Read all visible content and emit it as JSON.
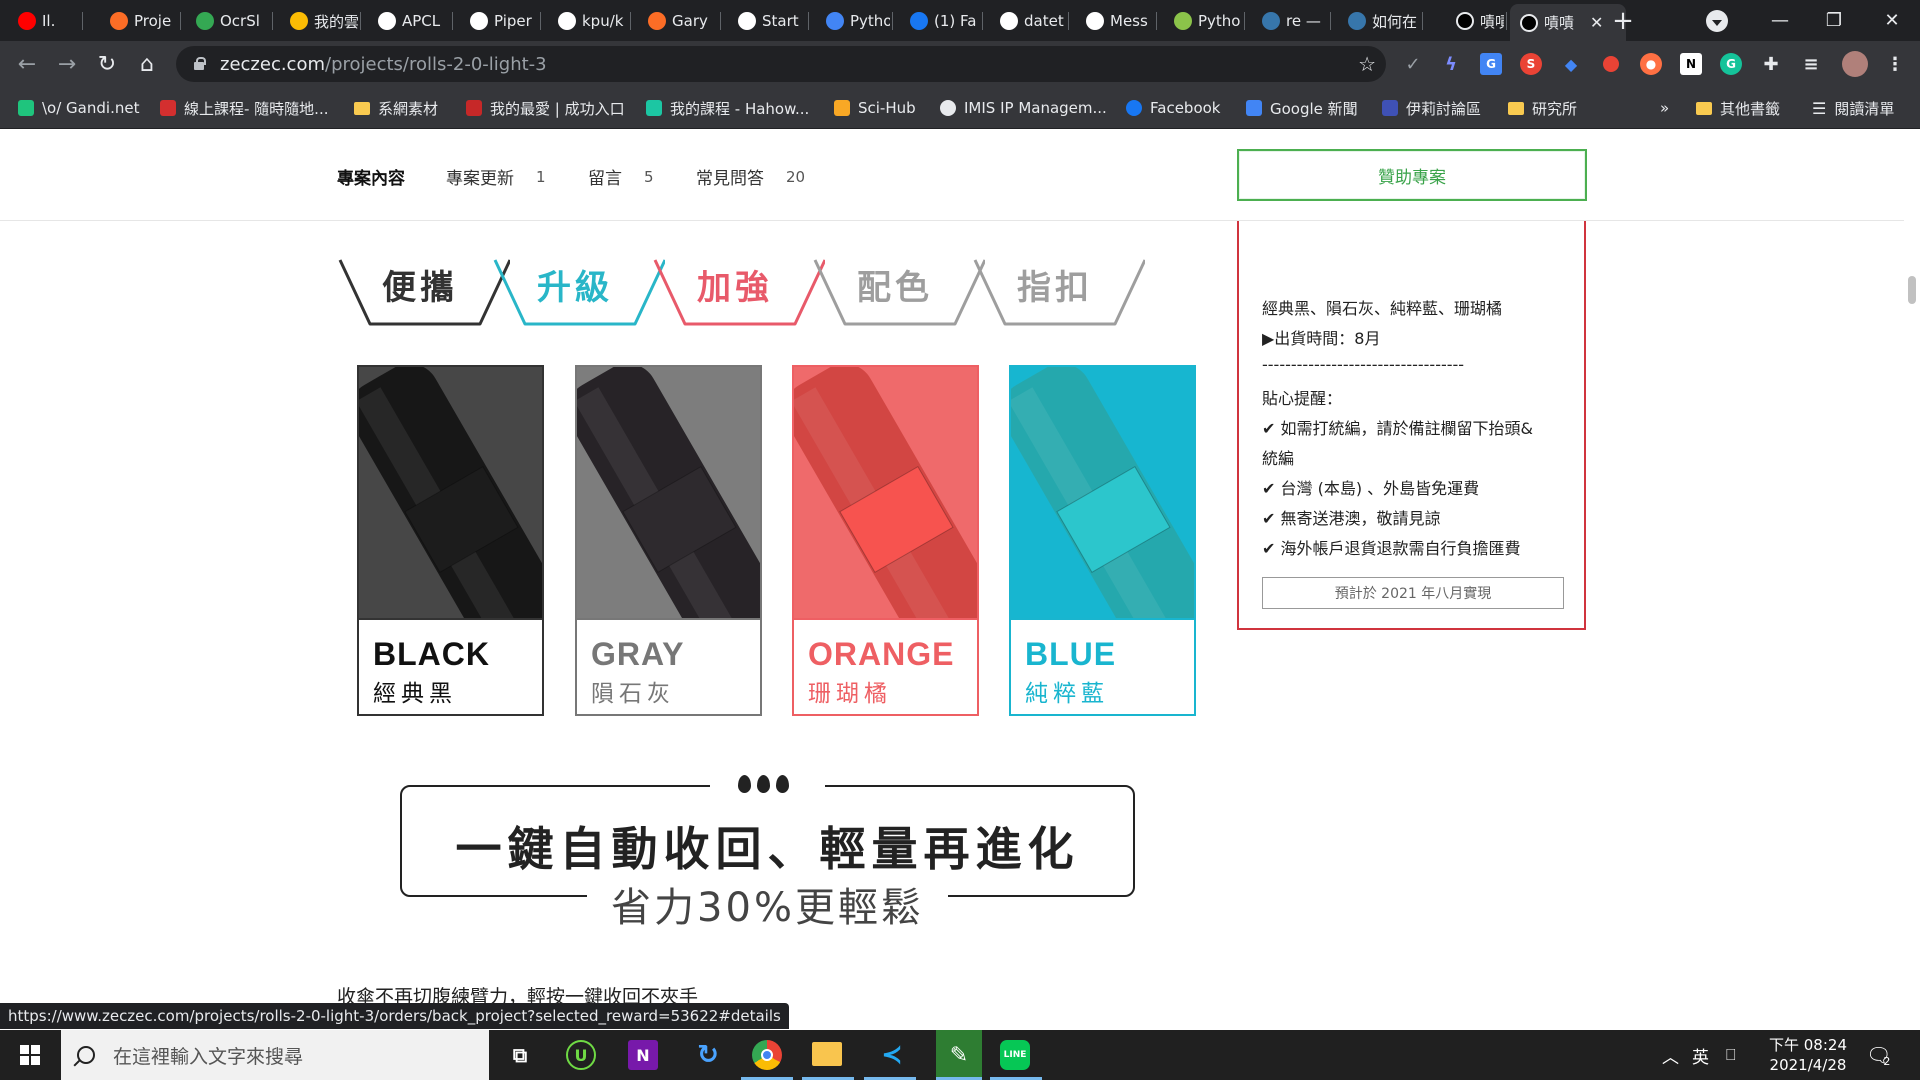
{
  "browser": {
    "tabs": [
      {
        "label": "Il.",
        "icon": "youtube-icon",
        "color": "#ff0000"
      },
      {
        "label": "Proje",
        "icon": "gitlab-icon",
        "color": "#fc6d26"
      },
      {
        "label": "OcrSl",
        "icon": "ocr-icon",
        "color": "#34a853"
      },
      {
        "label": "我的雲",
        "icon": "google-drive-icon",
        "color": "#fbbc04"
      },
      {
        "label": "APCL",
        "icon": "github-icon",
        "color": "#ffffff"
      },
      {
        "label": "Piper",
        "icon": "medium-icon",
        "color": "#ffffff"
      },
      {
        "label": "kpu/k",
        "icon": "github-icon",
        "color": "#ffffff"
      },
      {
        "label": "Gary",
        "icon": "gitlab-icon",
        "color": "#fc6d26"
      },
      {
        "label": "Start",
        "icon": "start-icon",
        "color": "#ffffff"
      },
      {
        "label": "Pytho",
        "icon": "gear-doc-icon",
        "color": "#4285f4"
      },
      {
        "label": "(1) Fa",
        "icon": "facebook-icon",
        "color": "#1877f2"
      },
      {
        "label": "datet",
        "icon": "google-icon",
        "color": "#ffffff"
      },
      {
        "label": "Mess",
        "icon": "google-icon",
        "color": "#ffffff"
      },
      {
        "label": "Pytho",
        "icon": "robot-icon",
        "color": "#8bc34a"
      },
      {
        "label": "re —",
        "icon": "python-icon",
        "color": "#3776ab"
      },
      {
        "label": "如何在",
        "icon": "python-icon",
        "color": "#3776ab"
      },
      {
        "label": "嘖嘖 |",
        "icon": "zeczec-icon",
        "color": "#202124"
      },
      {
        "label": "嘖嘖",
        "icon": "zeczec-icon",
        "color": "#111111",
        "active": true
      }
    ],
    "url_host": "zeczec.com",
    "url_path": "/projects/rolls-2-0-light-3",
    "bookmarks": [
      {
        "label": "\\o/ Gandi.net",
        "icon": "gandi-icon"
      },
      {
        "label": "線上課程- 隨時隨地...",
        "icon": "course-icon"
      },
      {
        "label": "系網素材",
        "icon": "folder-icon"
      },
      {
        "label": "我的最愛 | 成功入口",
        "icon": "ncku-icon"
      },
      {
        "label": "我的課程 - Hahow...",
        "icon": "hahow-icon"
      },
      {
        "label": "Sci-Hub",
        "icon": "scihub-icon"
      },
      {
        "label": "IMIS IP Managem...",
        "icon": "globe-icon"
      },
      {
        "label": "Facebook",
        "icon": "facebook-icon"
      },
      {
        "label": "Google 新聞",
        "icon": "google-news-icon"
      },
      {
        "label": "伊莉討論區",
        "icon": "eyny-icon"
      },
      {
        "label": "研究所",
        "icon": "folder-icon"
      }
    ],
    "bookmarks_overflow": "»",
    "other_bookmarks": "其他書籤",
    "reading_list": "閱讀清單"
  },
  "page": {
    "subnav": [
      {
        "label": "專案內容",
        "count": ""
      },
      {
        "label": "專案更新",
        "count": "1"
      },
      {
        "label": "留言",
        "count": "5"
      },
      {
        "label": "常見問答",
        "count": "20"
      }
    ],
    "sponsor_button": "贊助專案",
    "hexagons": [
      {
        "text": "便攜",
        "color": "#333333"
      },
      {
        "text": "升級",
        "color": "#29b6c8"
      },
      {
        "text": "加強",
        "color": "#e85a6a"
      },
      {
        "text": "配色",
        "color": "#9e9e9e"
      },
      {
        "text": "指扣",
        "color": "#9e9e9e"
      }
    ],
    "colors": [
      {
        "en": "BLACK",
        "zh": "經典黑",
        "accent": "#111111",
        "bg": "#474747",
        "fabric": "#1c1c1c"
      },
      {
        "en": "GRAY",
        "zh": "隕石灰",
        "accent": "#777777",
        "bg": "#7d7d7d",
        "fabric": "#2e2a2e"
      },
      {
        "en": "ORANGE",
        "zh": "珊瑚橘",
        "accent": "#ee5f63",
        "bg": "#ef6a6b",
        "fabric": "#f7534f"
      },
      {
        "en": "BLUE",
        "zh": "純粹藍",
        "accent": "#19b5cf",
        "bg": "#17b6d0",
        "fabric": "#2cc6cc"
      }
    ],
    "banner": {
      "title": "一鍵自動收回、輕量再進化",
      "subtitle": "省力30%更輕鬆"
    },
    "body_text": "收傘不再切腹練臂力，輕按一鍵收回不夾手",
    "reward": {
      "lines": [
        "經典黑、隕石灰、純粹藍、珊瑚橘",
        "▶出貨時間：8月",
        "-----------------------------------",
        "貼心提醒：",
        "✔ 如需打統編，請於備註欄留下抬頭&",
        "統編",
        "✔ 台灣 (本島) 、外島皆免運費",
        "✔ 無寄送港澳，敬請見諒",
        "✔ 海外帳戶退貨退款需自行負擔匯費"
      ],
      "estimate": "預計於 2021 年八月實現"
    },
    "status_url": "https://www.zeczec.com/projects/rolls-2-0-light-3/orders/back_project?selected_reward=53622#details"
  },
  "taskbar": {
    "search_placeholder": "在這裡輸入文字來搜尋",
    "apps": [
      "task-view-icon",
      "upwork-icon",
      "onenote-icon",
      "refresh-app-icon",
      "chrome-icon",
      "file-explorer-icon",
      "vscode-icon",
      "pen-app-icon",
      "line-icon"
    ],
    "ime": "英",
    "time": "下午 08:24",
    "date": "2021/4/28",
    "notifications": "2"
  }
}
